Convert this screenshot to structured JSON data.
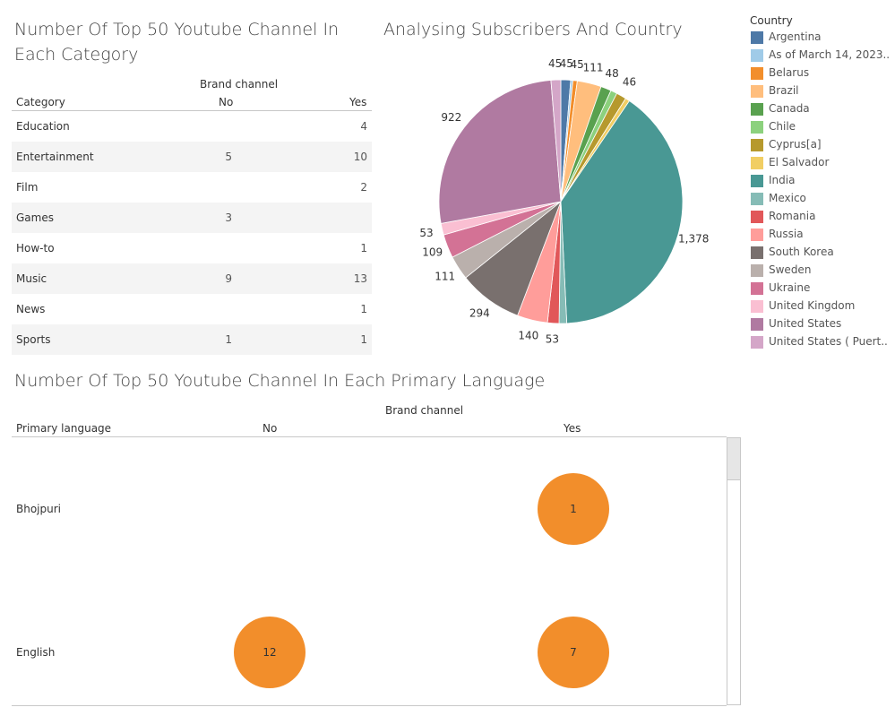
{
  "dashboard": {
    "category_title": "Number Of Top 50 Youtube Channel In Each Category",
    "pie_title": "Analysing Subscribers And Country",
    "language_title": "Number Of Top 50 Youtube Channel In Each Primary Language"
  },
  "category_table": {
    "group_header": "Brand channel",
    "row_header": "Category",
    "col_no": "No",
    "col_yes": "Yes",
    "rows": [
      {
        "category": "Education",
        "no": "",
        "yes": "4"
      },
      {
        "category": "Entertainment",
        "no": "5",
        "yes": "10"
      },
      {
        "category": "Film",
        "no": "",
        "yes": "2"
      },
      {
        "category": "Games",
        "no": "3",
        "yes": ""
      },
      {
        "category": "How-to",
        "no": "",
        "yes": "1"
      },
      {
        "category": "Music",
        "no": "9",
        "yes": "13"
      },
      {
        "category": "News",
        "no": "",
        "yes": "1"
      },
      {
        "category": "Sports",
        "no": "1",
        "yes": "1"
      }
    ]
  },
  "legend": {
    "title": "Country",
    "items": [
      {
        "label": "Argentina",
        "color": "#4e79a7"
      },
      {
        "label": "As of March 14, 2023..",
        "color": "#a0cbe8"
      },
      {
        "label": "Belarus",
        "color": "#f28e2b"
      },
      {
        "label": "Brazil",
        "color": "#ffbe7d"
      },
      {
        "label": "Canada",
        "color": "#59a14f"
      },
      {
        "label": "Chile",
        "color": "#8cd17d"
      },
      {
        "label": "Cyprus[a]",
        "color": "#b6992d"
      },
      {
        "label": "El Salvador",
        "color": "#f1ce63"
      },
      {
        "label": "India",
        "color": "#499894"
      },
      {
        "label": "Mexico",
        "color": "#86bcb6"
      },
      {
        "label": "Romania",
        "color": "#e15759"
      },
      {
        "label": "Russia",
        "color": "#ff9d9a"
      },
      {
        "label": "South Korea",
        "color": "#79706e"
      },
      {
        "label": "Sweden",
        "color": "#bab0ac"
      },
      {
        "label": "Ukraine",
        "color": "#d37295"
      },
      {
        "label": "United Kingdom",
        "color": "#fabfd2"
      },
      {
        "label": "United States",
        "color": "#b07aa1"
      },
      {
        "label": "United States ( Puert..",
        "color": "#d4a6c8"
      }
    ]
  },
  "chart_data": [
    {
      "type": "pie",
      "title": "Analysing Subscribers And Country",
      "categories": [
        "Argentina",
        "As of March 14, 2023..",
        "Belarus",
        "Brazil",
        "Canada",
        "Chile",
        "Cyprus[a]",
        "El Salvador",
        "India",
        "Mexico",
        "Romania",
        "Russia",
        "South Korea",
        "Sweden",
        "Ukraine",
        "United Kingdom",
        "United States",
        "United States ( Puert.."
      ],
      "values": [
        45,
        10,
        20,
        111,
        48,
        30,
        46,
        20,
        1378,
        35,
        53,
        140,
        294,
        111,
        109,
        53,
        922,
        45
      ],
      "labels": [
        "45",
        "",
        "45",
        "111",
        "48",
        "",
        "46",
        "",
        "1,378",
        "",
        "53",
        "140",
        "294",
        "111",
        "109",
        "53",
        "922",
        "45"
      ],
      "legend_position": "right"
    },
    {
      "type": "scatter",
      "title": "Number Of Top 50 Youtube Channel In Each Primary Language",
      "group_header": "Brand channel",
      "row_header": "Primary language",
      "columns": [
        "No",
        "Yes"
      ],
      "rows": [
        {
          "language": "Bhojpuri",
          "no": null,
          "yes": 1
        },
        {
          "language": "English",
          "no": 12,
          "yes": 7
        }
      ],
      "mark_color": "#f28e2b"
    }
  ]
}
